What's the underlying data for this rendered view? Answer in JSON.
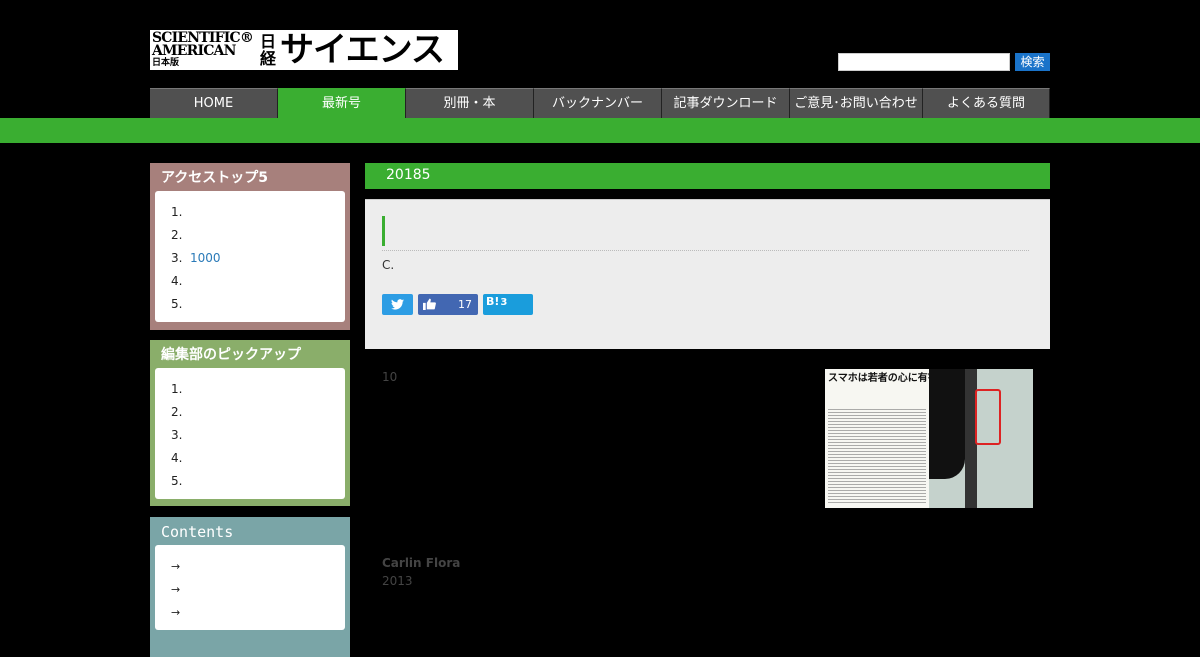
{
  "header": {
    "logo_sa_line1": "SCIENTIFIC®",
    "logo_sa_line2": "AMERICAN",
    "logo_sa_jp": "日本版",
    "logo_nikkei": "日経",
    "logo_science": "サイエンス",
    "search_button": "検索"
  },
  "nav": [
    {
      "label": "HOME"
    },
    {
      "label": "最新号"
    },
    {
      "label": "別冊・本"
    },
    {
      "label": "バックナンバー"
    },
    {
      "label": "記事ダウンロード"
    },
    {
      "label": "ご意見･お問い合わせ"
    },
    {
      "label": "よくある質問"
    }
  ],
  "sidebar": {
    "access_top5": {
      "title": "アクセストップ5",
      "items": [
        {
          "num": "1.",
          "text": ""
        },
        {
          "num": "2.",
          "text": ""
        },
        {
          "num": "3.",
          "text": "1000"
        },
        {
          "num": "4.",
          "text": ""
        },
        {
          "num": "5.",
          "text": ""
        }
      ]
    },
    "editor_pickup": {
      "title": "編集部のピックアップ",
      "items": [
        {
          "num": "1."
        },
        {
          "num": "2."
        },
        {
          "num": "3."
        },
        {
          "num": "4."
        },
        {
          "num": "5."
        }
      ]
    },
    "contents": {
      "title": "Contents",
      "items": [
        {
          "bullet": "→"
        },
        {
          "bullet": "→"
        },
        {
          "bullet": "→"
        }
      ]
    }
  },
  "main": {
    "issue": "20185",
    "author_initial": "C.",
    "facebook_count": "17",
    "hatena_label": "B!",
    "hatena_count": "3",
    "page_number": "10",
    "article_image_title": "スマホは若者の心に有害か",
    "author_name": "Carlin Flora",
    "year": "2013"
  },
  "colors": {
    "green": "#3aae31",
    "nav_gray": "#505050",
    "box1": "#a7807c",
    "box2": "#8aae6a",
    "box3": "#7aa5a7"
  },
  "icons": {
    "twitter": "twitter-bird-icon",
    "facebook": "thumbs-up-icon",
    "contents_bullet": "arrow-right-icon"
  }
}
